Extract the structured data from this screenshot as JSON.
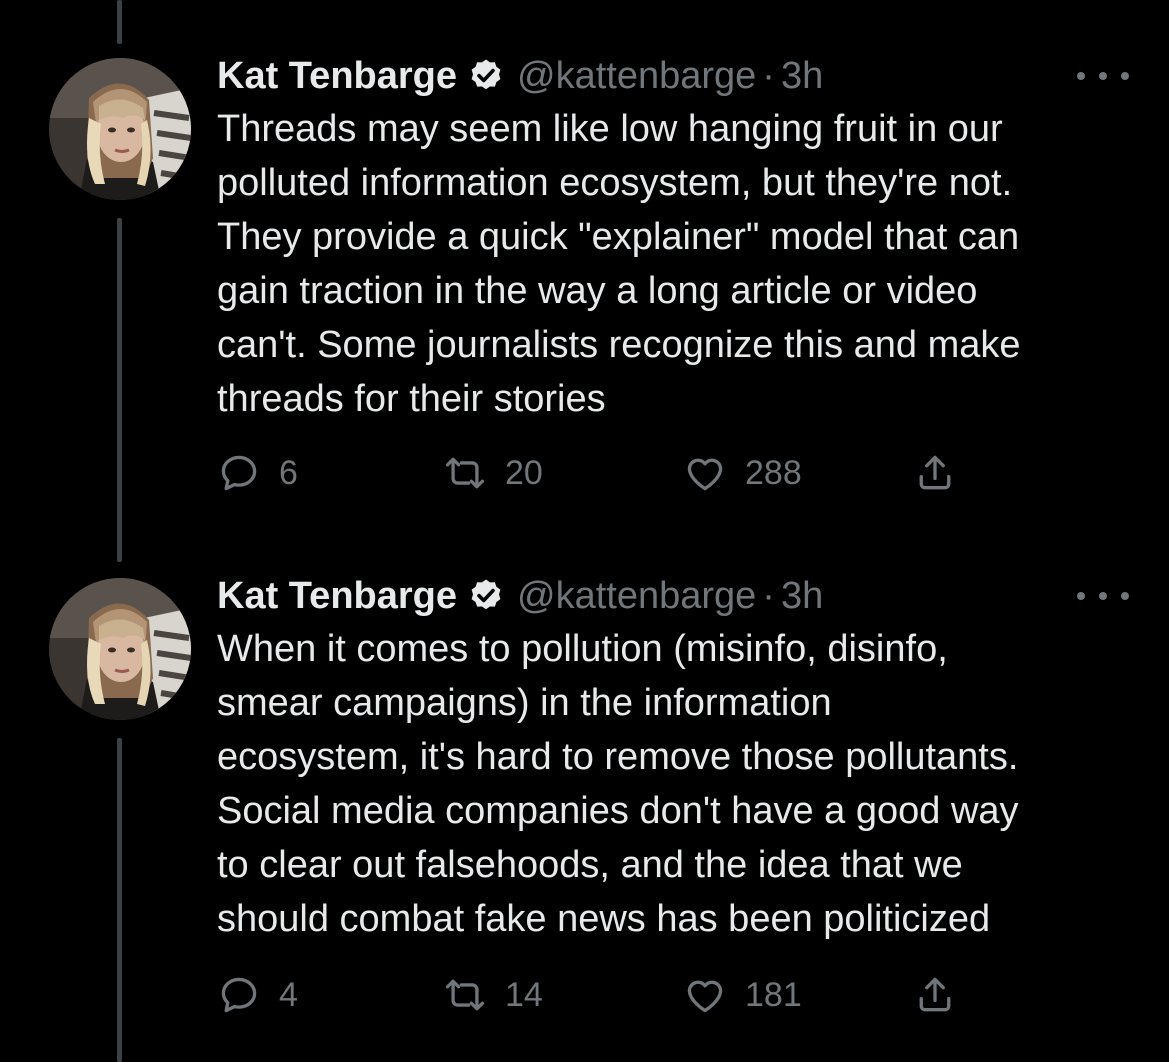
{
  "tweets": [
    {
      "author_name": "Kat Tenbarge",
      "handle": "@kattenbarge",
      "separator": "·",
      "time": "3h",
      "text_lines": [
        "Threads may seem like low hanging fruit in our",
        "polluted information ecosystem, but they're not.",
        "They provide a quick \"explainer\" model that can",
        "gain traction in the way a long article or video",
        "can't. Some journalists recognize this and make",
        "threads for their stories"
      ],
      "reply_count": "6",
      "retweet_count": "20",
      "like_count": "288"
    },
    {
      "author_name": "Kat Tenbarge",
      "handle": "@kattenbarge",
      "separator": "·",
      "time": "3h",
      "text_lines": [
        "When it comes to pollution (misinfo, disinfo,",
        "smear campaigns) in the information",
        "ecosystem, it's hard to remove those pollutants.",
        "Social media companies don't have a good way",
        "to clear out falsehoods, and the idea that we",
        "should combat fake news has been politicized"
      ],
      "reply_count": "4",
      "retweet_count": "14",
      "like_count": "181"
    }
  ],
  "icons": {
    "verified": "verified-badge-icon",
    "more": "more-options-icon",
    "reply": "reply-icon",
    "retweet": "retweet-icon",
    "like": "like-icon",
    "share": "share-icon"
  },
  "colors": {
    "background": "#000000",
    "primary_text": "#e7e9ea",
    "secondary_text": "#71767b",
    "thread_line": "#3e4144"
  }
}
